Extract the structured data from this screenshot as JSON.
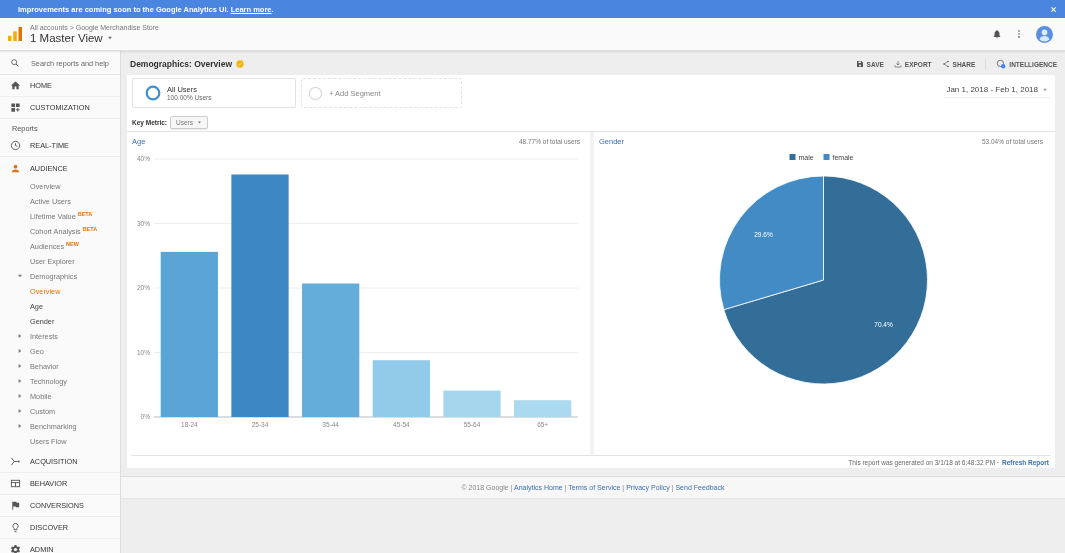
{
  "banner": {
    "text": "Improvements are coming soon to the Google Analytics UI.",
    "link": "Learn more",
    "link_suffix": "."
  },
  "header": {
    "breadcrumb": "All accounts > Google Merchandise Store",
    "view": "1 Master View"
  },
  "sidebar": {
    "search_placeholder": "Search reports and help",
    "items": [
      {
        "kind": "nav",
        "label": "HOME",
        "selected": false
      },
      {
        "kind": "nav",
        "label": "CUSTOMIZATION",
        "selected": false
      },
      {
        "kind": "heading",
        "label": "Reports"
      },
      {
        "kind": "nav",
        "label": "REAL-TIME",
        "selected": false
      },
      {
        "kind": "nav",
        "label": "AUDIENCE",
        "selected": true,
        "children": [
          {
            "label": "Overview",
            "selected": false
          },
          {
            "label": "Active Users",
            "selected": false
          },
          {
            "label": "Lifetime Value",
            "badge": "BETA",
            "selected": false
          },
          {
            "label": "Cohort Analysis",
            "badge": "BETA",
            "selected": false
          },
          {
            "label": "Audiences",
            "badge": "NEW",
            "selected": false
          },
          {
            "label": "User Explorer",
            "selected": false
          },
          {
            "label": "Demographics",
            "expanded": true,
            "selected": false,
            "children": [
              {
                "label": "Overview",
                "selected": true
              },
              {
                "label": "Age",
                "selected": false
              },
              {
                "label": "Gender",
                "selected": false
              }
            ]
          },
          {
            "label": "Interests",
            "expanded": false,
            "selected": false
          },
          {
            "label": "Geo",
            "expanded": false,
            "selected": false
          },
          {
            "label": "Behavior",
            "expanded": false,
            "selected": false
          },
          {
            "label": "Technology",
            "expanded": false,
            "selected": false
          },
          {
            "label": "Mobile",
            "expanded": false,
            "selected": false
          },
          {
            "label": "Custom",
            "expanded": false,
            "selected": false
          },
          {
            "label": "Benchmarking",
            "expanded": false,
            "selected": false
          },
          {
            "label": "Users Flow",
            "selected": false
          }
        ]
      },
      {
        "kind": "nav",
        "label": "ACQUISITION",
        "selected": false
      },
      {
        "kind": "nav",
        "label": "BEHAVIOR",
        "selected": false
      },
      {
        "kind": "nav",
        "label": "CONVERSIONS",
        "selected": false
      },
      {
        "kind": "nav",
        "label": "DISCOVER",
        "selected": false
      },
      {
        "kind": "nav",
        "label": "ADMIN",
        "selected": false
      }
    ]
  },
  "report": {
    "title": "Demographics: Overview",
    "toolbar": [
      "SAVE",
      "EXPORT",
      "SHARE",
      "INTELLIGENCE"
    ],
    "segments": [
      {
        "kind": "segment",
        "name": "All Users",
        "share": "100.00% Users"
      },
      {
        "kind": "add",
        "name": "+ Add Segment"
      }
    ],
    "date_range": "Jan 1, 2018 - Feb 1, 2018",
    "key_metric": {
      "label": "Key Metric:",
      "value": "Users"
    },
    "panels": [
      {
        "share": "48.77% of total users",
        "chart_data": {
          "type": "bar",
          "title": "Age",
          "categories": [
            "18-24",
            "25-34",
            "35-44",
            "45-54",
            "55-64",
            "65+"
          ],
          "values": [
            25.6,
            37.6,
            20.7,
            8.8,
            4.1,
            2.6
          ],
          "colors": [
            "#5aa5d6",
            "#3d88c4",
            "#64acd9",
            "#92cbe9",
            "#a6d6ee",
            "#abd9ef"
          ],
          "grid": true,
          "ylim": [
            0,
            40
          ],
          "yticks": [
            {
              "value": 0,
              "label": "0%"
            },
            {
              "value": 10,
              "label": "10%"
            },
            {
              "value": 20,
              "label": "20%"
            },
            {
              "value": 30,
              "label": "30%"
            },
            {
              "value": 40,
              "label": "40%"
            }
          ]
        }
      },
      {
        "share": "53.04% of total users",
        "chart_data": {
          "type": "pie",
          "title": "Gender",
          "categories": [
            "male",
            "female"
          ],
          "values": [
            70.4,
            29.6
          ],
          "colors": [
            "#336e98",
            "#428bc4"
          ],
          "legend": "top",
          "value_labels": [
            "70.4%",
            "29.6%"
          ]
        }
      }
    ],
    "generated": "This report was generated on 3/1/18 at 6:48:32 PM ·",
    "refresh": "Refresh Report"
  },
  "footer": {
    "items": [
      {
        "kind": "text",
        "text": "© 2018 Google"
      },
      {
        "kind": "separator",
        "text": "|"
      },
      {
        "kind": "link",
        "text": "Analytics Home"
      },
      {
        "kind": "separator",
        "text": "|"
      },
      {
        "kind": "link",
        "text": "Terms of Service"
      },
      {
        "kind": "separator",
        "text": "|"
      },
      {
        "kind": "link",
        "text": "Privacy Policy"
      },
      {
        "kind": "separator",
        "text": "|"
      },
      {
        "kind": "link",
        "text": "Send Feedback"
      }
    ]
  }
}
